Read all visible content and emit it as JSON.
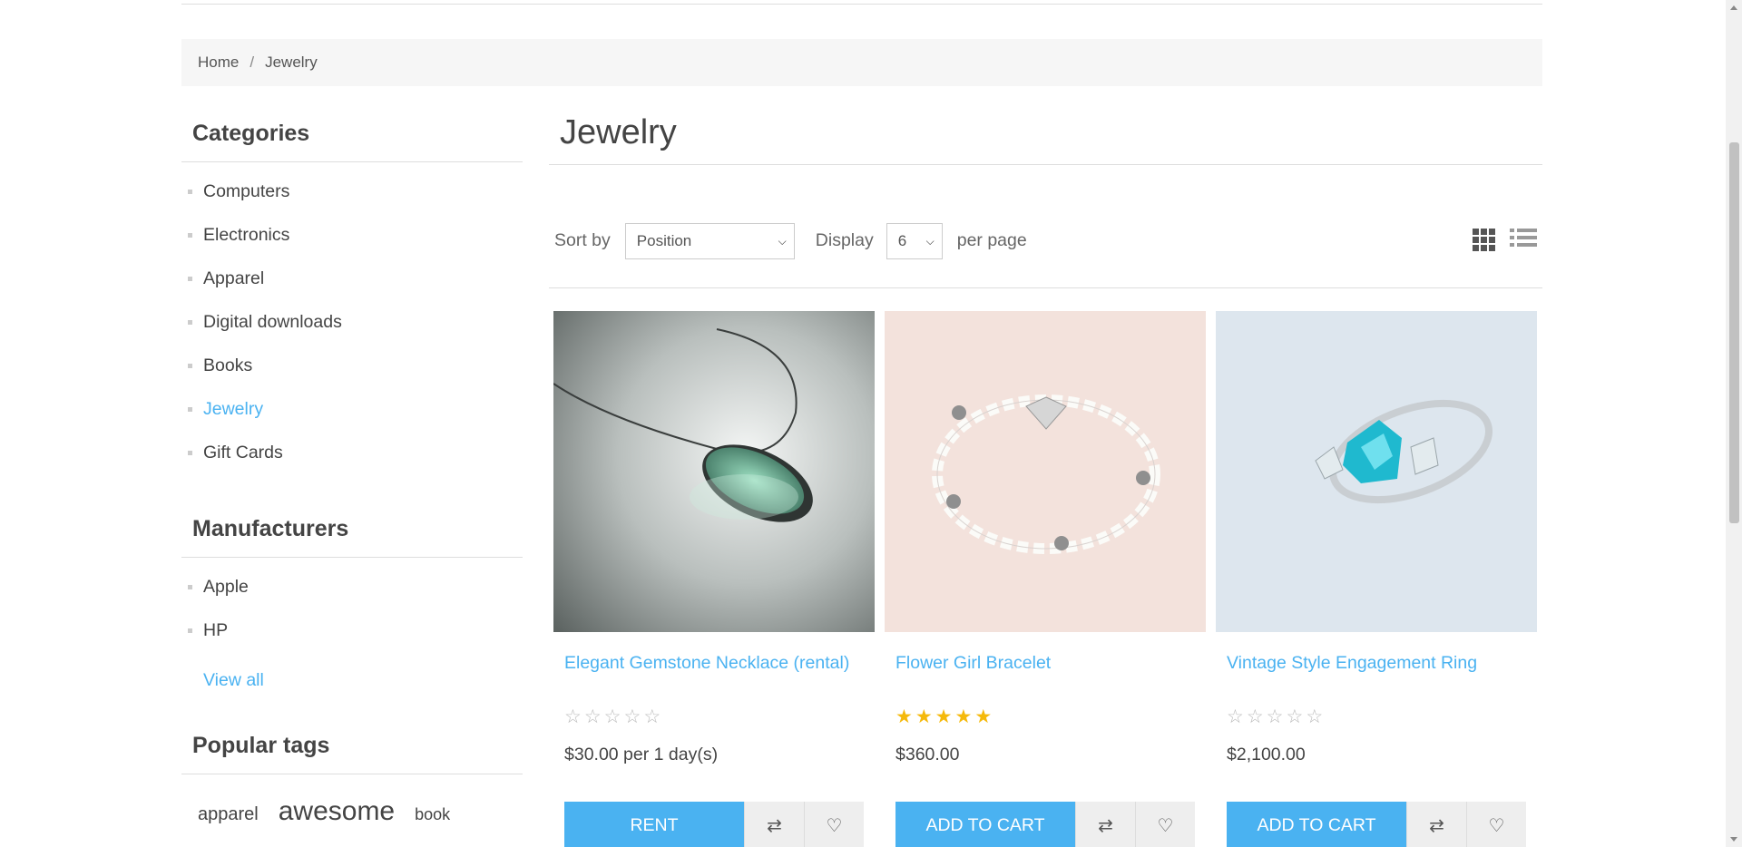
{
  "breadcrumb": {
    "home": "Home",
    "separator": "/",
    "current": "Jewelry"
  },
  "sidebar": {
    "categories_title": "Categories",
    "categories": [
      "Computers",
      "Electronics",
      "Apparel",
      "Digital downloads",
      "Books",
      "Jewelry",
      "Gift Cards"
    ],
    "active_category": "Jewelry",
    "manufacturers_title": "Manufacturers",
    "manufacturers": [
      "Apple",
      "HP"
    ],
    "view_all": "View all",
    "tags_title": "Popular tags",
    "tags": [
      "apparel",
      "awesome",
      "book"
    ]
  },
  "main": {
    "title": "Jewelry",
    "sort_label": "Sort by",
    "sort_value": "Position",
    "display_label": "Display",
    "display_value": "6",
    "per_page_label": "per page",
    "view_modes": [
      "grid-icon",
      "list-icon"
    ]
  },
  "products": [
    {
      "name": "Elegant Gemstone Necklace (rental)",
      "rating": 0,
      "price": "$30.00 per 1 day(s)",
      "button": "RENT"
    },
    {
      "name": "Flower Girl Bracelet",
      "rating": 5,
      "price": "$360.00",
      "button": "ADD TO CART"
    },
    {
      "name": "Vintage Style Engagement Ring",
      "rating": 0,
      "price": "$2,100.00",
      "button": "ADD TO CART"
    }
  ],
  "colors": {
    "accent": "#4ab2f1",
    "star_on": "#f5b90b",
    "breadcrumb_bg": "#f6f6f6"
  }
}
